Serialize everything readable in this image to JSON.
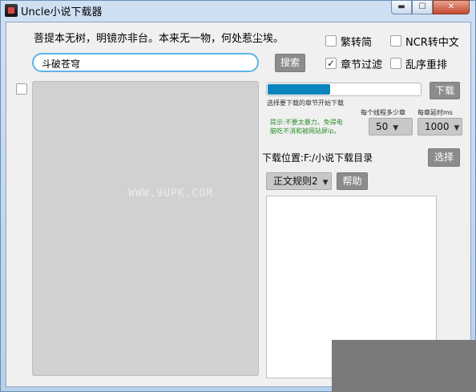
{
  "window": {
    "title": "Uncle小说下载器",
    "controls": {
      "minimize": "▬",
      "maximize": "☐",
      "close": "✕"
    }
  },
  "poem": "菩提本无树，明镜亦非台。本来无一物，何处惹尘埃。",
  "options": {
    "traditional_simplified": {
      "label": "繁转简",
      "checked": false
    },
    "ncr_to_chinese": {
      "label": "NCR转中文",
      "checked": false
    },
    "chapter_filter": {
      "label": "章节过滤",
      "checked": true
    },
    "shuffle_reorder": {
      "label": "乱序重排",
      "checked": false
    }
  },
  "search": {
    "value": "斗破苍穹",
    "button_label": "搜索"
  },
  "text_panel": {
    "watermark": "WWW.9UPK.COM"
  },
  "download": {
    "button_label": "下载",
    "progress": 0.41,
    "progress_caption": "选择要下载的章节开始下载"
  },
  "tip": {
    "line1": "提示:不要太暴力，免得电",
    "line2": "脑吃不消和被网站屏ip。"
  },
  "threads": {
    "label": "每个线程多少章",
    "value": "50"
  },
  "interval": {
    "label": "每章延时ms",
    "value": "1000"
  },
  "location": {
    "label": "下载位置:F:/小说下载目录",
    "choose_label": "选择"
  },
  "rules": {
    "value": "正文规则2",
    "help_label": "帮助"
  },
  "colors": {
    "progress_fill": "#0a85c0",
    "tip_text": "#2c8f2c",
    "search_border": "#5cb4e8"
  }
}
